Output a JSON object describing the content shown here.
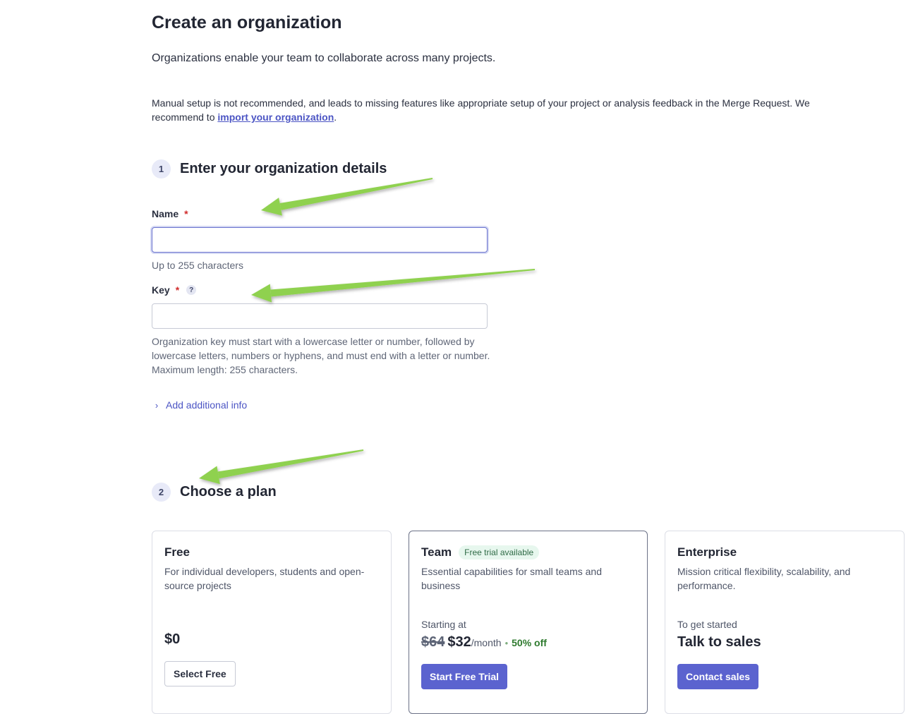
{
  "page": {
    "title": "Create an organization",
    "subtitle": "Organizations enable your team to collaborate across many projects.",
    "notice_text": "Manual setup is not recommended, and leads to missing features like appropriate setup of your project or analysis feedback in the Merge Request. We recommend to ",
    "notice_link": "import your organization",
    "notice_end": "."
  },
  "step1": {
    "number": "1",
    "title": "Enter your organization details",
    "name_label": "Name",
    "required_mark": "*",
    "name_value": "",
    "name_hint": "Up to 255 characters",
    "key_label": "Key",
    "key_help_icon": "?",
    "key_value": "",
    "key_hint": "Organization key must start with a lowercase letter or number, followed by lowercase letters, numbers or hyphens, and must end with a letter or number. Maximum length: 255 characters.",
    "add_info_label": "Add additional info"
  },
  "step2": {
    "number": "2",
    "title": "Choose a plan"
  },
  "plans": [
    {
      "name": "Free",
      "description": "For individual developers, students and open-source projects",
      "price": "$0",
      "button": "Select Free"
    },
    {
      "name": "Team",
      "badge": "Free trial available",
      "description": "Essential capabilities for small teams and business",
      "kicker": "Starting at",
      "old_price": "$64",
      "price": "$32",
      "period": "/month",
      "separator": "•",
      "discount": "50% off",
      "button": "Start Free Trial"
    },
    {
      "name": "Enterprise",
      "description": "Mission critical flexibility, scalability, and performance.",
      "kicker": "To get started",
      "headline": "Talk to sales",
      "button": "Contact sales"
    }
  ],
  "annotations": {
    "arrow_color": "#8fd14f"
  }
}
